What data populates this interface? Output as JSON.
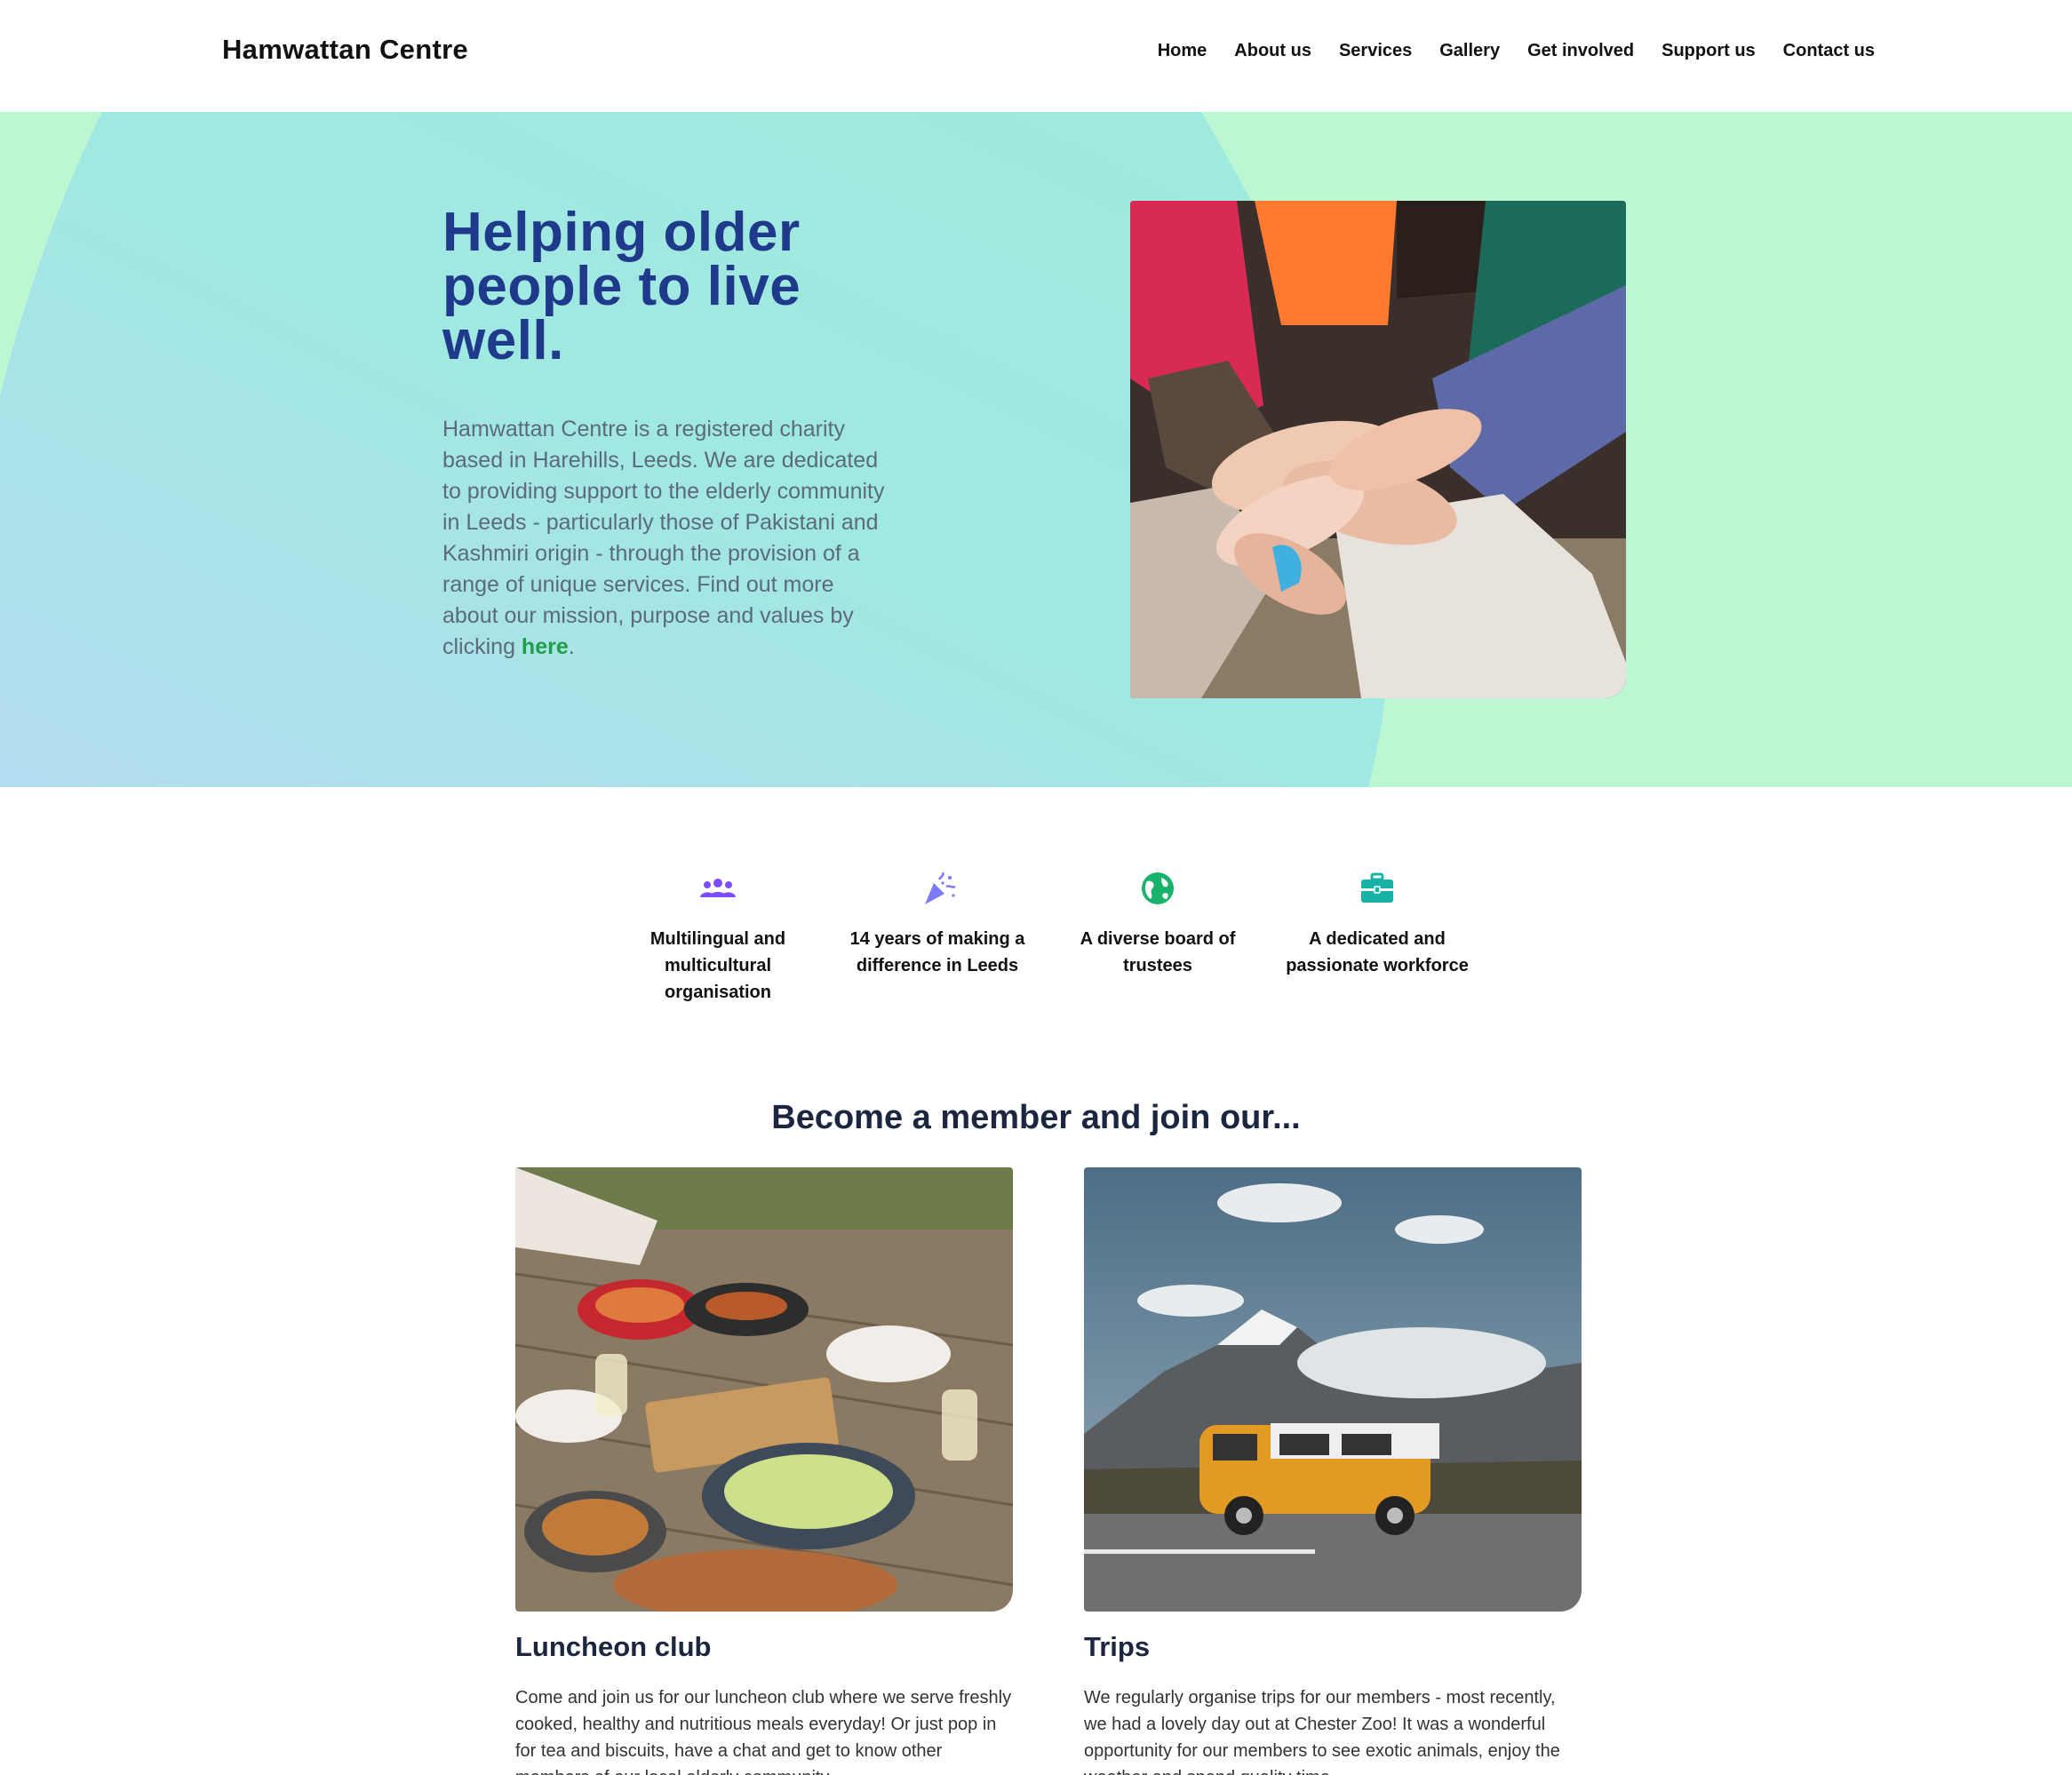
{
  "header": {
    "brand": "Hamwattan Centre",
    "nav": [
      "Home",
      "About us",
      "Services",
      "Gallery",
      "Get involved",
      "Support us",
      "Contact us"
    ]
  },
  "hero": {
    "title": "Helping older people to live well.",
    "body": "Hamwattan Centre is a registered charity based in Harehills, Leeds. We are dedicated to providing support to the elderly community in Leeds - particularly those of Pakistani and Kashmiri origin - through the provision of a range of unique services. Find out more about our mission, purpose and values by clicking ",
    "link_text": "here",
    "body_end": ".",
    "photo_icon": "stacked-hands-photo"
  },
  "features": [
    {
      "icon": "people-group-icon",
      "label": "Multilingual and multicultural organisation",
      "color": "#7c4dff"
    },
    {
      "icon": "party-popper-icon",
      "label": "14 years of making a difference in Leeds",
      "color": "#7b79f7"
    },
    {
      "icon": "globe-icon",
      "label": "A diverse board of trustees",
      "color": "#18b26b"
    },
    {
      "icon": "briefcase-icon",
      "label": "A dedicated and passionate workforce",
      "color": "#16b3a6"
    }
  ],
  "members": {
    "title": "Become a member and join our...",
    "cards": [
      {
        "title": "Luncheon club",
        "text": "Come and join us for our luncheon club where we serve freshly cooked, healthy and nutritious meals everyday! Or just pop in for tea and biscuits, have a chat and get to know other members of our local elderly community."
      },
      {
        "title": "Trips",
        "text": "We regularly organise trips for our members - most recently, we had a lovely day out at Chester Zoo! It was a wonderful opportunity for our members to see exotic animals, enjoy the weather and spend quality time."
      }
    ]
  },
  "colors": {
    "hero_green": "#bdf6d3",
    "hero_teal": "#9ee8e0",
    "title_blue": "#1f3a8a",
    "link_green": "#1f9e48"
  }
}
